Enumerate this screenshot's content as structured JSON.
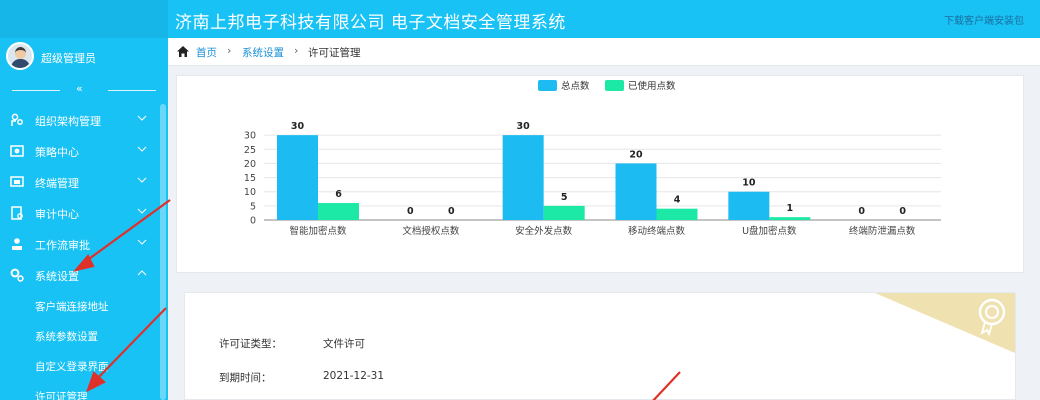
{
  "header": {
    "title": "济南上邦电子科技有限公司   电子文档安全管理系统",
    "download_link": "下载客户端安装包"
  },
  "user": {
    "name": "超级管理员"
  },
  "sidebar": {
    "collapse_icon": "«",
    "items": [
      {
        "label": "组织架构管理",
        "icon": "org-icon"
      },
      {
        "label": "策略中心",
        "icon": "policy-icon"
      },
      {
        "label": "终端管理",
        "icon": "terminal-icon"
      },
      {
        "label": "审计中心",
        "icon": "audit-icon"
      },
      {
        "label": "工作流审批",
        "icon": "workflow-icon"
      },
      {
        "label": "系统设置",
        "icon": "settings-icon"
      }
    ],
    "sub_items": [
      {
        "label": "客户端连接地址"
      },
      {
        "label": "系统参数设置"
      },
      {
        "label": "自定义登录界面"
      },
      {
        "label": "许可证管理"
      }
    ]
  },
  "breadcrumb": {
    "home": "首页",
    "level2": "系统设置",
    "current": "许可证管理"
  },
  "chart_data": {
    "type": "bar",
    "categories": [
      "智能加密点数",
      "文档授权点数",
      "安全外发点数",
      "移动终端点数",
      "U盘加密点数",
      "终端防泄漏点数"
    ],
    "series": [
      {
        "name": "总点数",
        "color": "#1cbcf2",
        "values": [
          30,
          0,
          30,
          20,
          10,
          0
        ]
      },
      {
        "name": "已使用点数",
        "color": "#1de9a6",
        "values": [
          6,
          0,
          5,
          4,
          1,
          0
        ]
      }
    ],
    "ylim": [
      0,
      35
    ],
    "yticks": [
      0,
      5,
      10,
      15,
      20,
      25,
      30
    ],
    "grid": true,
    "legend": "top-center"
  },
  "license": {
    "type_label": "许可证类型：",
    "type_value": "文件许可",
    "expire_label": "到期时间：",
    "expire_value": "2021-12-31"
  },
  "colors": {
    "accent": "#19c2f4",
    "breadcrumb_link": "#1a8fd6",
    "annotation_arrow": "#e0302a",
    "ribbon": "#efe2b0"
  }
}
